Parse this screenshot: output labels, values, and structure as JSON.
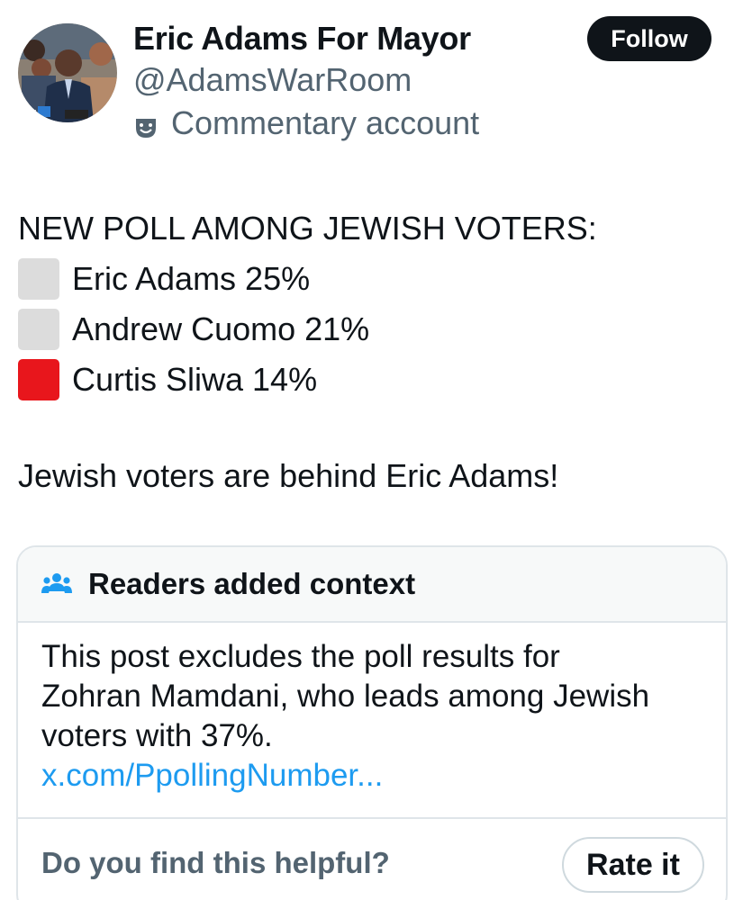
{
  "post": {
    "author": {
      "display_name": "Eric Adams For Mayor",
      "handle": "@AdamsWarRoom",
      "label_icon": "theater-masks-icon",
      "label": "Commentary account"
    },
    "follow_label": "Follow",
    "heading": "NEW POLL AMONG JEWISH VOTERS:",
    "results": [
      {
        "marker": "gray-square",
        "color": "#dcdcdc",
        "text": "Eric Adams 25%"
      },
      {
        "marker": "gray-square",
        "color": "#dcdcdc",
        "text": "Andrew Cuomo 21%"
      },
      {
        "marker": "red-square",
        "color": "#e8161c",
        "text": "Curtis Sliwa 14%"
      }
    ],
    "tagline": "Jewish voters are behind Eric Adams!"
  },
  "community_note": {
    "icon": "people-icon",
    "title": "Readers added context",
    "lines": [
      "This post excludes the poll results for",
      "Zohran Mamdani, who leads among Jewish",
      "voters with 37%."
    ],
    "link": "x.com/PpollingNumber...",
    "helpful_question": "Do you find this helpful?",
    "rate_label": "Rate it"
  },
  "colors": {
    "text": "#0f1419",
    "secondary": "#536471",
    "link": "#1d9bf0",
    "note_header_bg": "#f7f9f9",
    "border": "#dfe5e9"
  }
}
